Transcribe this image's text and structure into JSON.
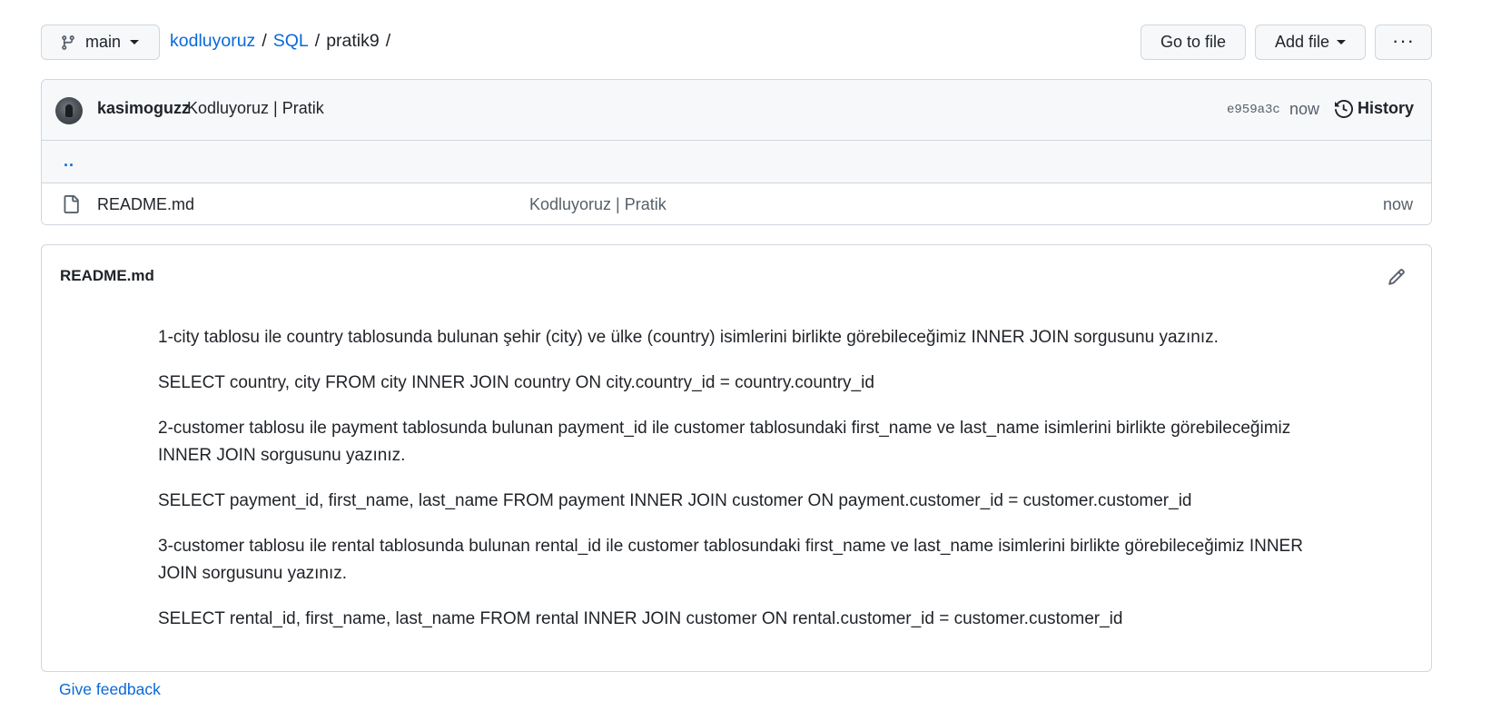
{
  "branch": {
    "name": "main",
    "icon": "git-branch-icon"
  },
  "breadcrumb": {
    "repo": "kodluyoruz",
    "folder": "SQL",
    "current": "pratik9",
    "separator": "/"
  },
  "actions": {
    "go_to_file": "Go to file",
    "add_file": "Add file",
    "more": "···"
  },
  "latest_commit": {
    "author": "kasimoguzz",
    "message": "Kodluyoruz | Pratik",
    "sha": "e959a3c",
    "time": "now",
    "history_label": "History"
  },
  "files": {
    "parent_link": "..",
    "rows": [
      {
        "name": "README.md",
        "message": "Kodluyoruz | Pratik",
        "time": "now",
        "icon": "file-icon"
      }
    ]
  },
  "readme": {
    "title": "README.md",
    "paragraphs": [
      "1-city tablosu ile country tablosunda bulunan şehir (city) ve ülke (country) isimlerini birlikte görebileceğimiz INNER JOIN sorgusunu yazınız.",
      "SELECT country, city FROM city INNER JOIN country ON city.country_id = country.country_id",
      "2-customer tablosu ile payment tablosunda bulunan payment_id ile customer tablosundaki first_name ve last_name isimlerini birlikte görebileceğimiz INNER JOIN sorgusunu yazınız.",
      "SELECT payment_id, first_name, last_name FROM payment INNER JOIN customer ON payment.customer_id = customer.customer_id",
      "3-customer tablosu ile rental tablosunda bulunan rental_id ile customer tablosundaki first_name ve last_name isimlerini birlikte görebileceğimiz INNER JOIN sorgusunu yazınız.",
      "SELECT rental_id, first_name, last_name FROM rental INNER JOIN customer ON rental.customer_id = customer.customer_id"
    ]
  },
  "feedback": "Give feedback",
  "colors": {
    "link": "#0969da",
    "border": "#d0d7de",
    "header_bg": "#f6f8fa",
    "text": "#1f2328",
    "muted": "#57606a"
  }
}
